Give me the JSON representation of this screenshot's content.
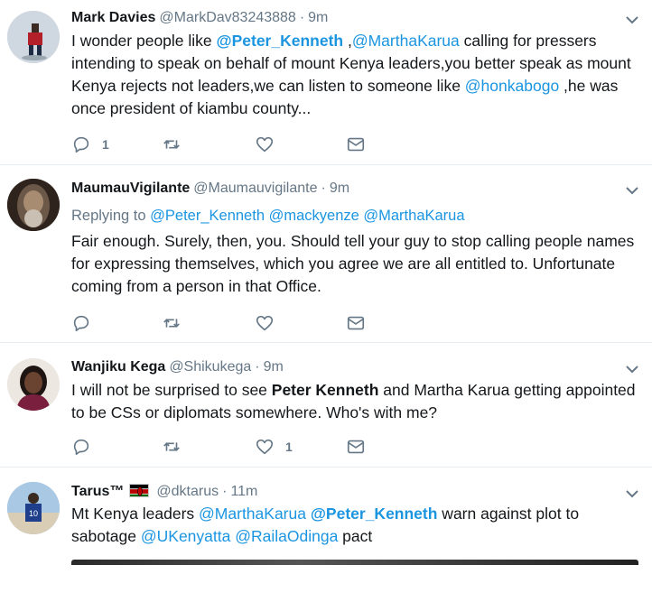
{
  "tweets": [
    {
      "name": "Mark Davies",
      "handle": "@MarkDav83243888",
      "dot": "·",
      "time": "9m",
      "text_parts": [
        {
          "t": "I wonder people like ",
          "s": "text"
        },
        {
          "t": "@Peter_Kenneth",
          "s": "linkbold"
        },
        {
          "t": " ,",
          "s": "text"
        },
        {
          "t": "@MarthaKarua",
          "s": "link"
        },
        {
          "t": " calling for pressers intending to speak on behalf of mount Kenya leaders,you better speak as mount Kenya rejects not leaders,we can listen to someone like ",
          "s": "text"
        },
        {
          "t": "@honkabogo",
          "s": "link"
        },
        {
          "t": " ,he was once president of kiambu county...",
          "s": "text"
        }
      ],
      "reply_count": "1",
      "retweet_count": "",
      "like_count": ""
    },
    {
      "name": "MaumauVigilante",
      "handle": "@Maumauvigilante",
      "dot": "·",
      "time": "9m",
      "replying_label": "Replying to",
      "replying_to": [
        "@Peter_Kenneth",
        "@mackyenze",
        "@MarthaKarua"
      ],
      "text": "Fair enough. Surely, then, you. Should tell your guy to stop calling people names for expressing themselves, which you agree we are all entitled to. Unfortunate coming from a person in that Office.",
      "reply_count": "",
      "retweet_count": "",
      "like_count": ""
    },
    {
      "name": "Wanjiku Kega",
      "handle": "@Shikukega",
      "dot": "·",
      "time": "9m",
      "text_parts": [
        {
          "t": "I will not be surprised to see ",
          "s": "text"
        },
        {
          "t": "Peter Kenneth",
          "s": "bold"
        },
        {
          "t": " and Martha Karua getting appointed to be CSs or diplomats somewhere. Who's with me?",
          "s": "text"
        }
      ],
      "reply_count": "",
      "retweet_count": "",
      "like_count": "1"
    },
    {
      "name": "Tarus™",
      "handle": "@dktarus",
      "dot": "·",
      "time": "11m",
      "text_parts": [
        {
          "t": "Mt Kenya leaders ",
          "s": "text"
        },
        {
          "t": "@MarthaKarua",
          "s": "link"
        },
        {
          "t": " ",
          "s": "text"
        },
        {
          "t": "@Peter_Kenneth",
          "s": "linkbold"
        },
        {
          "t": " warn against plot to sabotage ",
          "s": "text"
        },
        {
          "t": "@UKenyatta",
          "s": "link"
        },
        {
          "t": " ",
          "s": "text"
        },
        {
          "t": "@RailaOdinga",
          "s": "link"
        },
        {
          "t": " pact",
          "s": "text"
        }
      ]
    }
  ],
  "icons": {
    "reply": "reply-icon",
    "retweet": "retweet-icon",
    "like": "heart-icon",
    "dm": "envelope-icon",
    "caret": "chevron-down-icon",
    "flag": "kenya-flag-icon"
  },
  "colors": {
    "link": "#1b95e0",
    "muted": "#657786",
    "text": "#14171a",
    "divider": "#e6ecf0"
  }
}
